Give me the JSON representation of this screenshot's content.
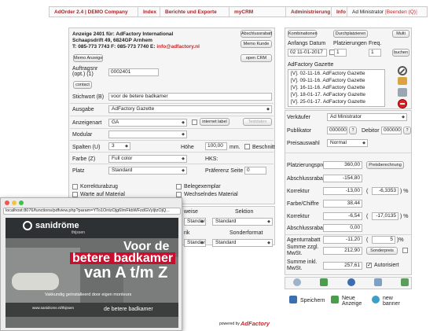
{
  "nav": {
    "brand": "AdOrder 2.4 | DEMO Company",
    "items": [
      "Index",
      "Berichte und Exporte",
      "myCRM",
      "Administrierung",
      "Info"
    ],
    "user": "Ad Ministrator",
    "logout": "Beenden (Q)"
  },
  "customer": {
    "line1": "Anzeige 2401 für: AdFactory International",
    "line2": "Schaapsdrift 49, 6824GP Arnhem",
    "line3": "T: 085-773 7743 F: 085-773 7740 E:",
    "email": "info@adfactory.nl",
    "btn_memo_kunde": "Memo Kunde",
    "btn_memo_anzeige": "Memo Anzeige",
    "btn_abschlussrabatt": "Abschlussrabatt",
    "btn_open_crm": "open CRM"
  },
  "form": {
    "auftragsnr_label1": "Auftragsnr",
    "auftragsnr_label2": "(opt.) (1)",
    "auftragsnr_value": "0002401",
    "contact_button": "contact",
    "stichwort_label": "Stichwort (B)",
    "stichwort_value": "voor de betere badkamer",
    "ausgabe_label": "Ausgabe",
    "ausgabe_value": "AdFactory Gazette",
    "anzeigenart_label": "Anzeigenart",
    "anzeigenart_value": "GA",
    "internet_label": "internet label",
    "internet_button": "Testdaten",
    "modular_label": "Modular",
    "modular_value": "",
    "spalten_label": "Spalten (U)",
    "spalten_value": "3",
    "hoehe_label": "Höhe",
    "hoehe_value": "100,00",
    "hoehe_unit": "mm.",
    "beschnitt_label": "Beschnitt",
    "farbe_label": "Farbe (Z)",
    "farbe_value": "Full color",
    "hks_label": "HKS:",
    "platz_label": "Platz",
    "platz_value": "Standard",
    "praeferenz_label": "Präferenz Seite",
    "praeferenz_value": "0",
    "korrekturabzug": "Korrekturabzug",
    "belegexemplar": "Belegexemplar",
    "warte_material": "Warte auf Material",
    "wechselndes_material": "Wechselndes Material",
    "col_zahlungsweise": "weise",
    "col_sektion": "Sektion",
    "row1_sel1": "Standard",
    "row1_sel2": "Standard",
    "col_sonderformat": "Sonderformat",
    "col_k": "rik",
    "row2_sel1": "Standard",
    "row2_sel2": "Standard"
  },
  "schedule": {
    "btn_kombinationen": "Kombinationen",
    "btn_durchplatzieren": "Durchplatzieren",
    "btn_multi": "Multi",
    "anfangs_label": "Anfangs Datum",
    "platzierungen_label": "Platzierungen",
    "freq_label": "Freq.",
    "date_value": "02 11-01-2017",
    "platz_value": "1",
    "freq_value": "1",
    "btn_buchen": "buchen",
    "gazette_title": "AdFactory Gazette",
    "items": [
      "[V]. 02-11-16. AdFactory Gazette",
      "[V]. 09-11-16. AdFactory Gazette",
      "[V]. 16-11-16. AdFactory Gazette",
      "[V]. 18-01-17. AdFactory Gazette",
      "[V]. 25-01-17. AdFactory Gazette"
    ]
  },
  "pricing": {
    "verkaeufer_label": "Verkäufer",
    "verkaeufer_value": "Ad Ministrator",
    "publikator_label": "Publikator",
    "publikator_value": "0000000",
    "debitor_label": "Debitor",
    "debitor_value": "0000000",
    "preisauswahl_label": "Preisauswahl",
    "preisauswahl_value": "Normal",
    "platzierungspreis_label": "Platzierungspreis",
    "platzierungspreis_value": "360,00",
    "btn_preisberechnung": "Preisberechnung",
    "abschlussrabatt_label": "Abschlussrabatt",
    "abschlussrabatt_value": "-154,80",
    "korrektur1_label": "Korrektur",
    "korrektur1_value": "-13,00",
    "korrektur1_pct": "-6,3353",
    "pct_sign": "%",
    "farbe_chiffre_label": "Farbe/Chiffre",
    "farbe_chiffre_value": "38,44",
    "korrektur2_label": "Korrektur",
    "korrektur2_value": "-6,54",
    "korrektur2_pct": "-17,0135",
    "abschlussrabatt2_label": "Abschlussrabatt",
    "abschlussrabatt2_value": "0,00",
    "agenturrabatt_label": "Agenturrabatt",
    "agenturrabatt_value": "-11,20",
    "agenturrabatt_pct": "5",
    "summe_zzgl_label1": "Summe zzgl.",
    "summe_zzgl_label2": "MwSt.",
    "summe_zzgl_value": "212,90",
    "btn_sonderpreis": "Sonderpreis",
    "summe_inkl_label1": "Summe inkl.",
    "summe_inkl_label2": "MwSt.",
    "summe_inkl_value": "257,61",
    "autorisiert_label": "Autorisiert"
  },
  "actions": {
    "speichern": "Speichern",
    "neue_anzeige1": "Neue",
    "neue_anzeige2": "Anzeige",
    "new_banner1": "new",
    "new_banner2": "banner"
  },
  "footer": {
    "powered_by": "powered by",
    "brand": "AdFactory"
  },
  "popup": {
    "url": "localhost:8076/functions/pdfview.php?param=YTo1OntzOjg6ImFkbWFzdGVyIjtzOjQ...",
    "logo": "sanidröme",
    "logo_sub": "thijssen",
    "headline1": "Voor de",
    "headline2": "betere badkamer",
    "headline3": "van A t/m Z",
    "tagline": "Vakkundig geïnstalleerd door eigen monteurs",
    "contact": "www.sanidrome.nl/thijssen",
    "footer": "de betere badkamer",
    "accent": "#c8102e"
  }
}
